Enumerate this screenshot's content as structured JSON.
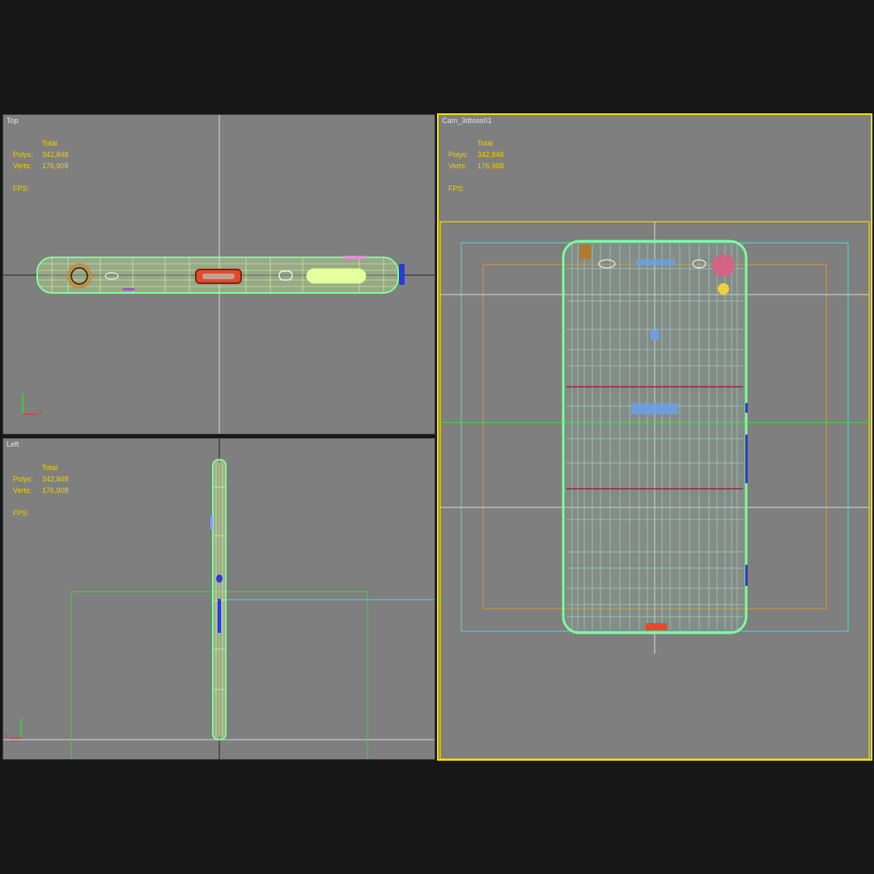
{
  "viewports": {
    "top": {
      "label": "Top",
      "stats": {
        "header": "Total",
        "polys_label": "Polys:",
        "polys": "342,848",
        "verts_label": "Verts:",
        "verts": "176,908",
        "fps_label": "FPS:"
      }
    },
    "left": {
      "label": "Left",
      "stats": {
        "header": "Total",
        "polys_label": "Polys:",
        "polys": "342,848",
        "verts_label": "Verts:",
        "verts": "176,908",
        "fps_label": "FPS:"
      }
    },
    "camera": {
      "label": "Cam_3dtoss01",
      "stats": {
        "header": "Total",
        "polys_label": "Polys:",
        "polys": "342,848",
        "verts_label": "Verts:",
        "verts": "176,908",
        "fps_label": "FPS:"
      }
    }
  },
  "axis_labels": {
    "top_y": "y",
    "top_x": "x",
    "left_z": "z",
    "left_y": "y"
  },
  "active_viewport": "camera",
  "colors": {
    "viewport_bg": "#7f7f7f",
    "stats_text": "#f0d000",
    "active_border": "#f2e300",
    "wireframe": "#ccffa0",
    "wire_outline": "#7dff9a",
    "grid_line": "#d8d8d8"
  },
  "icons": [
    "axis-tripod-icon"
  ]
}
